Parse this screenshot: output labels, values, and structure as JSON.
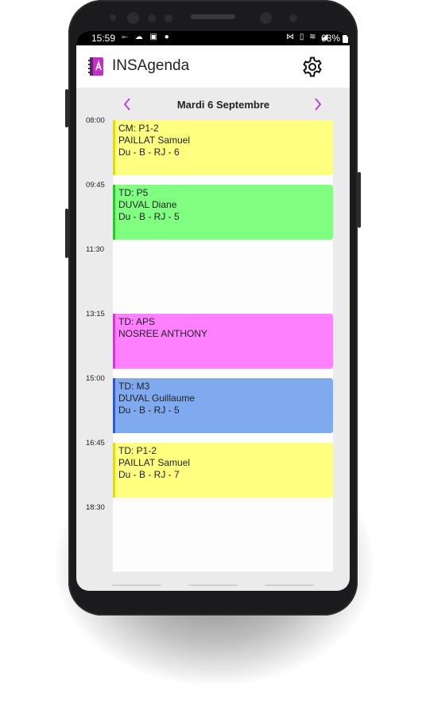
{
  "status": {
    "time": "15:59",
    "left_icons": "⟜ ☁ ▣ ●",
    "right_icons": "⋈ ▯ ≋ ◢",
    "battery": "68%"
  },
  "app": {
    "title": "INSAgenda",
    "logo_icon": "agenda-book-icon",
    "settings_icon": "gear-icon"
  },
  "date_nav": {
    "title": "Mardi 6 Septembre",
    "prev_icon": "chevron-left-icon",
    "next_icon": "chevron-right-icon",
    "accent": "#c033e0"
  },
  "times": [
    "08:00",
    "09:45",
    "11:30",
    "13:15",
    "15:00",
    "16:45",
    "18:30"
  ],
  "events": [
    {
      "lines": [
        "CM: P1-2",
        "PAILLAT Samuel",
        "Du - B - RJ - 6"
      ],
      "slot": 0,
      "bg": "#ffff80",
      "bar": "#e2dc00"
    },
    {
      "lines": [
        "TD: P5",
        "DUVAL Diane",
        "Du - B - RJ - 5"
      ],
      "slot": 1,
      "bg": "#80ff80",
      "bar": "#22cc22"
    },
    {
      "lines": [
        "TD: APS",
        "NOSREE ANTHONY"
      ],
      "slot": 3,
      "bg": "#ff80ff",
      "bar": "#dd33dd"
    },
    {
      "lines": [
        "TD: M3",
        "DUVAL Guillaume",
        "Du - B - RJ - 5"
      ],
      "slot": 4,
      "bg": "#80aaf0",
      "bar": "#2a5ad8"
    },
    {
      "lines": [
        "TD: P1-2",
        "PAILLAT Samuel",
        "Du - B - RJ - 7"
      ],
      "slot": 5,
      "bg": "#ffff80",
      "bar": "#e2dc00"
    }
  ]
}
